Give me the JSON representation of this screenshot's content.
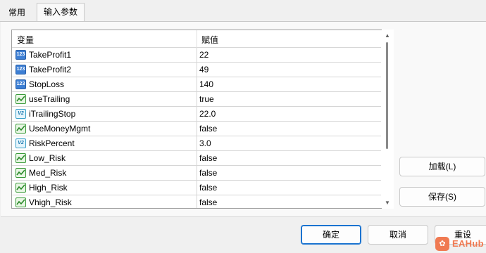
{
  "tabs": [
    {
      "label": "常用"
    },
    {
      "label": "输入参数"
    }
  ],
  "grid": {
    "col_variable": "变量",
    "col_value": "赋值",
    "rows": [
      {
        "type": "int",
        "icon_text": "123",
        "name": "TakeProfit1",
        "value": "22"
      },
      {
        "type": "int",
        "icon_text": "123",
        "name": "TakeProfit2",
        "value": "49"
      },
      {
        "type": "int",
        "icon_text": "123",
        "name": "StopLoss",
        "value": "140"
      },
      {
        "type": "bool",
        "icon_text": "",
        "name": "useTrailing",
        "value": "true"
      },
      {
        "type": "dbl",
        "icon_text": "V2",
        "name": "iTrailingStop",
        "value": "22.0"
      },
      {
        "type": "bool",
        "icon_text": "",
        "name": "UseMoneyMgmt",
        "value": "false"
      },
      {
        "type": "dbl",
        "icon_text": "V2",
        "name": "RiskPercent",
        "value": "3.0"
      },
      {
        "type": "bool",
        "icon_text": "",
        "name": "Low_Risk",
        "value": "false"
      },
      {
        "type": "bool",
        "icon_text": "",
        "name": "Med_Risk",
        "value": "false"
      },
      {
        "type": "bool",
        "icon_text": "",
        "name": "High_Risk",
        "value": "false"
      },
      {
        "type": "bool",
        "icon_text": "",
        "name": "Vhigh_Risk",
        "value": "false"
      }
    ]
  },
  "buttons": {
    "load": "加载(L)",
    "save": "保存(S)",
    "ok": "确定",
    "cancel": "取消",
    "reset": "重设"
  },
  "watermark": {
    "text": "EAHub"
  },
  "colors": {
    "accent": "#1a73d0",
    "watermark": "#f07a52"
  }
}
